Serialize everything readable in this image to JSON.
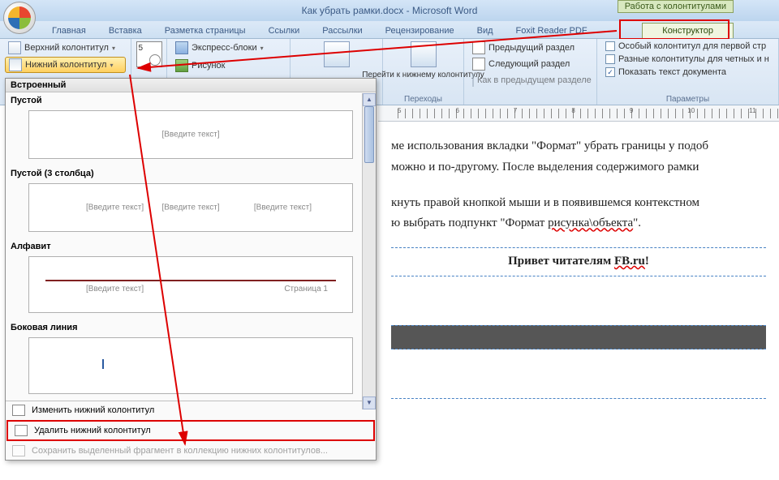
{
  "title": "Как убрать рамки.docx - Microsoft Word",
  "context_tool_label": "Работа с колонтитулами",
  "tabs": {
    "home": "Главная",
    "insert": "Вставка",
    "layout": "Разметка страницы",
    "refs": "Ссылки",
    "mail": "Рассылки",
    "review": "Рецензирование",
    "view": "Вид",
    "foxit": "Foxit Reader PDF",
    "designer": "Конструктор"
  },
  "ribbon": {
    "header_btn": "Верхний колонтитул",
    "footer_btn": "Нижний колонтитул",
    "express": "Экспресс-блоки",
    "picture": "Рисунок",
    "goto_footer": "Перейти к нижнему колонтитулу",
    "prev_section": "Предыдущий раздел",
    "next_section": "Следующий раздел",
    "as_prev": "Как в предыдущем разделе",
    "transitions_label": "Переходы",
    "opt_first": "Особый колонтитул для первой стр",
    "opt_odd_even": "Разные колонтитулы для четных и н",
    "opt_show_doc": "Показать текст документа",
    "params_label": "Параметры"
  },
  "dropdown": {
    "builtin": "Встроенный",
    "empty": "Пустой",
    "empty3": "Пустой (3 столбца)",
    "alphabet": "Алфавит",
    "sideline": "Боковая линия",
    "placeholder": "[Введите текст]",
    "page_label": "Страница 1",
    "edit_footer": "Изменить нижний колонтитул",
    "remove_footer": "Удалить нижний колонтитул",
    "save_selection": "Сохранить выделенный фрагмент в коллекцию нижних колонтитулов..."
  },
  "ruler_marks": [
    "5",
    "6",
    "7",
    "8",
    "9",
    "10",
    "11"
  ],
  "doc": {
    "p1": "ме использования вкладки \"Формат\" убрать границы у подоб",
    "p2": "можно и по-другому. После выделения содержимого рамки",
    "p3": "кнуть правой кнопкой мыши и в появившемся контекстном",
    "p4a": "ю выбрать подпункт \"Формат ",
    "p4b": "рисунка\\объекта",
    "p4c": "\".",
    "footer_a": "Привет читателям ",
    "footer_b": "FB.ru",
    "footer_c": "!"
  }
}
